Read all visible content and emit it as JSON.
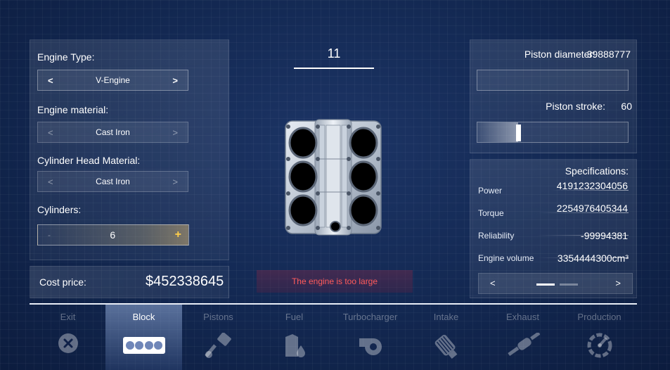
{
  "engine_type": {
    "label": "Engine Type:",
    "value": "V-Engine",
    "prev": "<",
    "next": ">"
  },
  "engine_material": {
    "label": "Engine material:",
    "value": "Cast Iron",
    "prev": "<",
    "next": ">"
  },
  "head_material": {
    "label": "Cylinder Head Material:",
    "value": "Cast Iron",
    "prev": "<",
    "next": ">"
  },
  "cylinders": {
    "label": "Cylinders:",
    "value": "6",
    "minus": "-",
    "plus": "+"
  },
  "cost": {
    "label": "Cost price:",
    "value": "$452338645"
  },
  "counter": "11",
  "warning": "The engine is too large",
  "piston_diameter": {
    "label": "Piston diameter:",
    "value": "39888777",
    "level": 0
  },
  "piston_stroke": {
    "label": "Piston stroke:",
    "value": "60",
    "level": 0.27
  },
  "specs": {
    "title": "Specifications:",
    "power": {
      "label": "Power",
      "value": "4191232304056"
    },
    "torque": {
      "label": "Torque",
      "value": "2254976405344"
    },
    "reliability": {
      "label": "Reliability",
      "value": "-99994381"
    },
    "volume": {
      "label": "Engine volume",
      "value": "3354444300cm³"
    }
  },
  "pager": {
    "prev": "<",
    "next": ">"
  },
  "tabs": [
    {
      "label": "Exit",
      "icon": "close-circle-icon"
    },
    {
      "label": "Block",
      "icon": "engine-block-icon",
      "active": true
    },
    {
      "label": "Pistons",
      "icon": "piston-icon"
    },
    {
      "label": "Fuel",
      "icon": "fuel-icon"
    },
    {
      "label": "Turbocharger",
      "icon": "turbocharger-icon"
    },
    {
      "label": "Intake",
      "icon": "air-filter-icon"
    },
    {
      "label": "Exhaust",
      "icon": "exhaust-icon"
    },
    {
      "label": "Production",
      "icon": "gauge-icon"
    }
  ],
  "colors": {
    "warning": "#ff5b5b",
    "plus_accent": "#ffce4a"
  }
}
